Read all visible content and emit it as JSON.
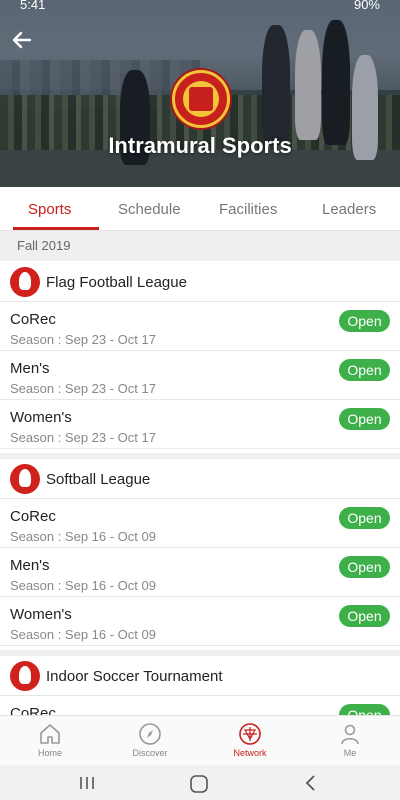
{
  "status": {
    "time": "5:41",
    "battery": "90%"
  },
  "header": {
    "title": "Intramural Sports"
  },
  "tabs": [
    {
      "label": "Sports",
      "active": true
    },
    {
      "label": "Schedule",
      "active": false
    },
    {
      "label": "Facilities",
      "active": false
    },
    {
      "label": "Leaders",
      "active": false
    }
  ],
  "term": "Fall 2019",
  "leagues": [
    {
      "title": "Flag Football League",
      "rows": [
        {
          "name": "CoRec",
          "season": "Season : Sep 23 - Oct 17",
          "status": "Open"
        },
        {
          "name": "Men's",
          "season": "Season : Sep 23 - Oct 17",
          "status": "Open"
        },
        {
          "name": "Women's",
          "season": "Season : Sep 23 - Oct 17",
          "status": "Open"
        }
      ]
    },
    {
      "title": "Softball League",
      "rows": [
        {
          "name": "CoRec",
          "season": "Season : Sep 16 - Oct 09",
          "status": "Open"
        },
        {
          "name": "Men's",
          "season": "Season : Sep 16 - Oct 09",
          "status": "Open"
        },
        {
          "name": "Women's",
          "season": "Season : Sep 16 - Oct 09",
          "status": "Open"
        }
      ]
    },
    {
      "title": "Indoor Soccer Tournament",
      "rows": [
        {
          "name": "CoRec",
          "season": "",
          "status": "Open"
        }
      ]
    }
  ],
  "nav": [
    {
      "label": "Home",
      "icon": "home-icon",
      "active": false
    },
    {
      "label": "Discover",
      "icon": "compass-icon",
      "active": false
    },
    {
      "label": "Network",
      "icon": "network-icon",
      "active": true
    },
    {
      "label": "Me",
      "icon": "person-icon",
      "active": false
    }
  ],
  "colors": {
    "accent": "#c8201c",
    "open": "#3db04a"
  }
}
